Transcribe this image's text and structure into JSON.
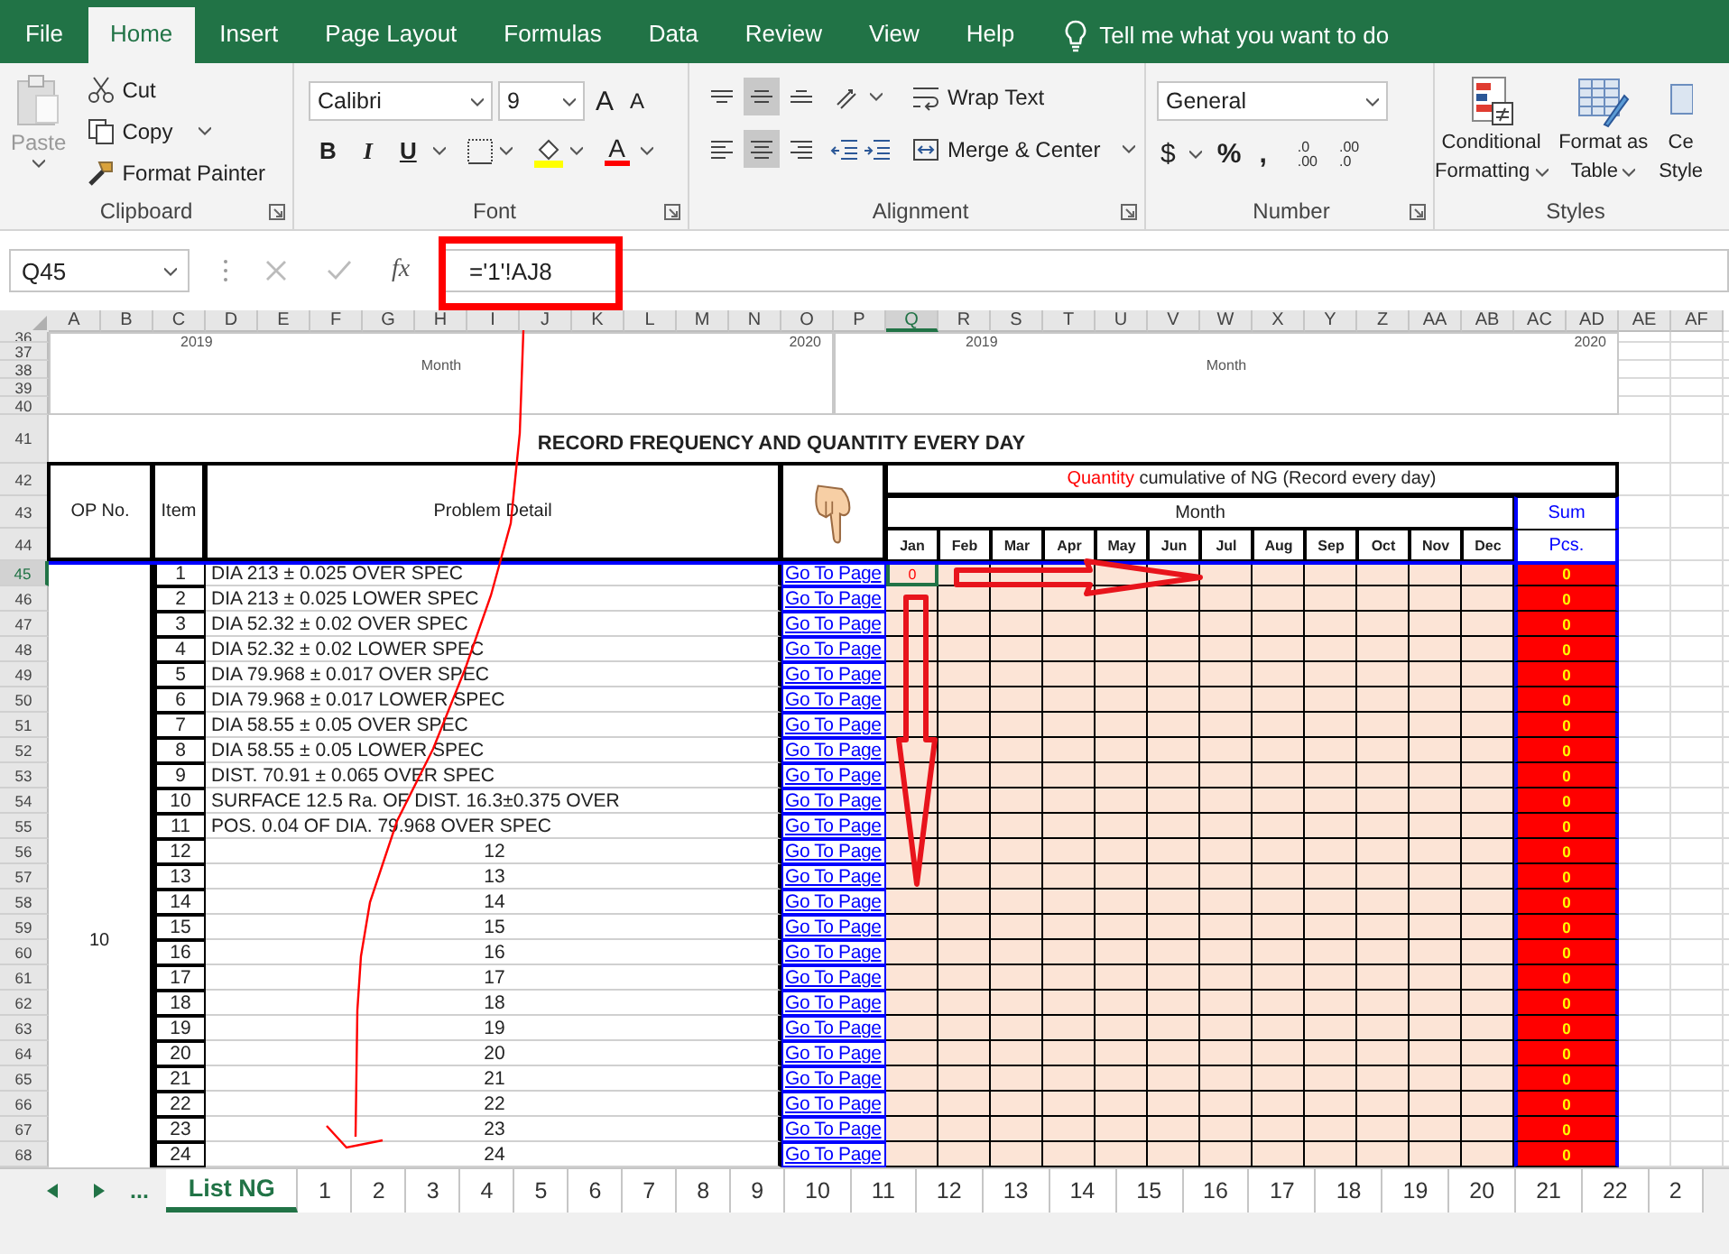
{
  "ribbon_tabs": [
    {
      "label": "File",
      "selected": false
    },
    {
      "label": "Home",
      "selected": true
    },
    {
      "label": "Insert",
      "selected": false
    },
    {
      "label": "Page Layout",
      "selected": false
    },
    {
      "label": "Formulas",
      "selected": false
    },
    {
      "label": "Data",
      "selected": false
    },
    {
      "label": "Review",
      "selected": false
    },
    {
      "label": "View",
      "selected": false
    },
    {
      "label": "Help",
      "selected": false
    }
  ],
  "tell_me": "Tell me what you want to do",
  "clipboard": {
    "paste": "Paste",
    "paste_disabled": true,
    "cut": "Cut",
    "copy": "Copy",
    "format_painter": "Format Painter",
    "title": "Clipboard"
  },
  "font": {
    "name": "Calibri",
    "size": "9",
    "grow": "A",
    "shrink": "A",
    "bold": "B",
    "italic": "I",
    "underline": "U",
    "color_letter": "A",
    "title": "Font"
  },
  "alignment": {
    "vertical": [
      {
        "kind": "top",
        "selected": false
      },
      {
        "kind": "middle",
        "selected": true
      },
      {
        "kind": "bottom",
        "selected": false
      }
    ],
    "horizontal": [
      {
        "kind": "left",
        "selected": false
      },
      {
        "kind": "center",
        "selected": true
      },
      {
        "kind": "right",
        "selected": false
      }
    ],
    "wrap": "Wrap Text",
    "merge": "Merge & Center",
    "title": "Alignment"
  },
  "number": {
    "format": "General",
    "currency": "$",
    "percent": "%",
    "comma": ",",
    "increase_decimal": {
      "top": ".0",
      "bottom": ".00"
    },
    "decrease_decimal": {
      "top": ".00",
      "bottom": ".0"
    },
    "title": "Number"
  },
  "styles": {
    "conditional": [
      "Conditional",
      "Formatting"
    ],
    "table": [
      "Format as",
      "Table"
    ],
    "cell": [
      "Ce",
      "Style"
    ],
    "title": "Styles"
  },
  "name_box": "Q45",
  "insert_function": "fx",
  "formula": "='1'!AJ8",
  "columns": [
    {
      "label": "A",
      "selected": false
    },
    {
      "label": "B",
      "selected": false
    },
    {
      "label": "C",
      "selected": false
    },
    {
      "label": "D",
      "selected": false
    },
    {
      "label": "E",
      "selected": false
    },
    {
      "label": "F",
      "selected": false
    },
    {
      "label": "G",
      "selected": false
    },
    {
      "label": "H",
      "selected": false
    },
    {
      "label": "I",
      "selected": false
    },
    {
      "label": "J",
      "selected": false
    },
    {
      "label": "K",
      "selected": false
    },
    {
      "label": "L",
      "selected": false
    },
    {
      "label": "M",
      "selected": false
    },
    {
      "label": "N",
      "selected": false
    },
    {
      "label": "O",
      "selected": false
    },
    {
      "label": "P",
      "selected": false
    },
    {
      "label": "Q",
      "selected": true
    },
    {
      "label": "R",
      "selected": false
    },
    {
      "label": "S",
      "selected": false
    },
    {
      "label": "T",
      "selected": false
    },
    {
      "label": "U",
      "selected": false
    },
    {
      "label": "V",
      "selected": false
    },
    {
      "label": "W",
      "selected": false
    },
    {
      "label": "X",
      "selected": false
    },
    {
      "label": "Y",
      "selected": false
    },
    {
      "label": "Z",
      "selected": false
    },
    {
      "label": "AA",
      "selected": false
    },
    {
      "label": "AB",
      "selected": false
    },
    {
      "label": "AC",
      "selected": false
    },
    {
      "label": "AD",
      "selected": false
    },
    {
      "label": "AE",
      "selected": false
    },
    {
      "label": "AF",
      "selected": false
    }
  ],
  "row_numbers": [
    {
      "label": "36",
      "selected": false
    },
    {
      "label": "37",
      "selected": false
    },
    {
      "label": "38",
      "selected": false
    },
    {
      "label": "39",
      "selected": false
    },
    {
      "label": "40",
      "selected": false
    },
    {
      "label": "41",
      "selected": false
    },
    {
      "label": "42",
      "selected": false
    },
    {
      "label": "43",
      "selected": false
    },
    {
      "label": "44",
      "selected": false
    },
    {
      "label": "45",
      "selected": true
    },
    {
      "label": "46",
      "selected": false
    },
    {
      "label": "47",
      "selected": false
    },
    {
      "label": "48",
      "selected": false
    },
    {
      "label": "49",
      "selected": false
    },
    {
      "label": "50",
      "selected": false
    },
    {
      "label": "51",
      "selected": false
    },
    {
      "label": "52",
      "selected": false
    },
    {
      "label": "53",
      "selected": false
    },
    {
      "label": "54",
      "selected": false
    },
    {
      "label": "55",
      "selected": false
    },
    {
      "label": "56",
      "selected": false
    },
    {
      "label": "57",
      "selected": false
    },
    {
      "label": "58",
      "selected": false
    },
    {
      "label": "59",
      "selected": false
    },
    {
      "label": "60",
      "selected": false
    },
    {
      "label": "61",
      "selected": false
    },
    {
      "label": "62",
      "selected": false
    },
    {
      "label": "63",
      "selected": false
    },
    {
      "label": "64",
      "selected": false
    },
    {
      "label": "65",
      "selected": false
    },
    {
      "label": "66",
      "selected": false
    },
    {
      "label": "67",
      "selected": false
    },
    {
      "label": "68",
      "selected": false
    }
  ],
  "chart_panels": [
    {
      "year_start": "2019",
      "year_end": "2020",
      "axis_label": "Month"
    },
    {
      "year_start": "2019",
      "year_end": "2020",
      "axis_label": "Month"
    }
  ],
  "title": "RECORD FREQUENCY AND QUANTITY EVERY DAY",
  "headers": {
    "op_no": "OP No.",
    "item": "Item",
    "detail": "Problem Detail",
    "quantity_highlight": "Quantity",
    "quantity_rest": "cumulative of NG (Record every day)",
    "month": "Month",
    "months": [
      "Jan",
      "Feb",
      "Mar",
      "Apr",
      "May",
      "Jun",
      "Jul",
      "Aug",
      "Sep",
      "Oct",
      "Nov",
      "Dec"
    ],
    "sum": "Sum",
    "pcs": "Pcs."
  },
  "op_no": "10",
  "records": [
    {
      "item": "1",
      "detail": "DIA 213 ± 0.025 OVER  SPEC",
      "kind": "text",
      "link": "Go To Page",
      "jan": "0",
      "sum": "0",
      "selected": true
    },
    {
      "item": "2",
      "detail": "DIA 213 ± 0.025 LOWER  SPEC",
      "kind": "text",
      "link": "Go To Page",
      "sum": "0",
      "selected": false
    },
    {
      "item": "3",
      "detail": "DIA 52.32 ± 0.02 OVER SPEC",
      "kind": "text",
      "link": "Go To Page",
      "sum": "0",
      "selected": false
    },
    {
      "item": "4",
      "detail": "DIA 52.32 ± 0.02 LOWER SPEC",
      "kind": "text",
      "link": "Go To Page",
      "sum": "0",
      "selected": false
    },
    {
      "item": "5",
      "detail": "DIA 79.968 ± 0.017 OVER SPEC",
      "kind": "text",
      "link": "Go To Page",
      "sum": "0",
      "selected": false
    },
    {
      "item": "6",
      "detail": "DIA 79.968 ± 0.017 LOWER SPEC",
      "kind": "text",
      "link": "Go To Page",
      "sum": "0",
      "selected": false
    },
    {
      "item": "7",
      "detail": "DIA 58.55 ± 0.05 OVER SPEC",
      "kind": "text",
      "link": "Go To Page",
      "sum": "0",
      "selected": false
    },
    {
      "item": "8",
      "detail": "DIA 58.55 ± 0.05 LOWER  SPEC",
      "kind": "text",
      "link": "Go To Page",
      "sum": "0",
      "selected": false
    },
    {
      "item": "9",
      "detail": "DIST. 70.91 ± 0.065 OVER SPEC",
      "kind": "text",
      "link": "Go To Page",
      "sum": "0",
      "selected": false
    },
    {
      "item": "10",
      "detail": "SURFACE 12.5 Ra. OF DIST. 16.3±0.375 OVER",
      "kind": "text",
      "link": "Go To Page",
      "sum": "0",
      "selected": false
    },
    {
      "item": "11",
      "detail": "POS. 0.04 OF DIA. 79.968  OVER SPEC",
      "kind": "text",
      "link": "Go To Page",
      "sum": "0",
      "selected": false
    },
    {
      "item": "12",
      "detail": "12",
      "kind": "number",
      "link": "Go To Page",
      "sum": "0",
      "selected": false
    },
    {
      "item": "13",
      "detail": "13",
      "kind": "number",
      "link": "Go To Page",
      "sum": "0",
      "selected": false
    },
    {
      "item": "14",
      "detail": "14",
      "kind": "number",
      "link": "Go To Page",
      "sum": "0",
      "selected": false
    },
    {
      "item": "15",
      "detail": "15",
      "kind": "number",
      "link": "Go To Page",
      "sum": "0",
      "selected": false
    },
    {
      "item": "16",
      "detail": "16",
      "kind": "number",
      "link": "Go To Page",
      "sum": "0",
      "selected": false
    },
    {
      "item": "17",
      "detail": "17",
      "kind": "number",
      "link": "Go To Page",
      "sum": "0",
      "selected": false
    },
    {
      "item": "18",
      "detail": "18",
      "kind": "number",
      "link": "Go To Page",
      "sum": "0",
      "selected": false
    },
    {
      "item": "19",
      "detail": "19",
      "kind": "number",
      "link": "Go To Page",
      "sum": "0",
      "selected": false
    },
    {
      "item": "20",
      "detail": "20",
      "kind": "number",
      "link": "Go To Page",
      "sum": "0",
      "selected": false
    },
    {
      "item": "21",
      "detail": "21",
      "kind": "number",
      "link": "Go To Page",
      "sum": "0",
      "selected": false
    },
    {
      "item": "22",
      "detail": "22",
      "kind": "number",
      "link": "Go To Page",
      "sum": "0",
      "selected": false
    },
    {
      "item": "23",
      "detail": "23",
      "kind": "number",
      "link": "Go To Page",
      "sum": "0",
      "selected": false
    },
    {
      "item": "24",
      "detail": "24",
      "kind": "number",
      "link": "Go To Page",
      "sum": "0",
      "selected": false
    }
  ],
  "sheet_more": "...",
  "sheet_tabs": [
    {
      "label": "List NG",
      "selected": true
    },
    {
      "label": "1",
      "selected": false
    },
    {
      "label": "2",
      "selected": false
    },
    {
      "label": "3",
      "selected": false
    },
    {
      "label": "4",
      "selected": false
    },
    {
      "label": "5",
      "selected": false
    },
    {
      "label": "6",
      "selected": false
    },
    {
      "label": "7",
      "selected": false
    },
    {
      "label": "8",
      "selected": false
    },
    {
      "label": "9",
      "selected": false
    },
    {
      "label": "10",
      "selected": false
    },
    {
      "label": "11",
      "selected": false
    },
    {
      "label": "12",
      "selected": false
    },
    {
      "label": "13",
      "selected": false
    },
    {
      "label": "14",
      "selected": false
    },
    {
      "label": "15",
      "selected": false
    },
    {
      "label": "16",
      "selected": false
    },
    {
      "label": "17",
      "selected": false
    },
    {
      "label": "18",
      "selected": false
    },
    {
      "label": "19",
      "selected": false
    },
    {
      "label": "20",
      "selected": false
    },
    {
      "label": "21",
      "selected": false
    },
    {
      "label": "22",
      "selected": false
    },
    {
      "label": "2",
      "selected": false
    }
  ]
}
